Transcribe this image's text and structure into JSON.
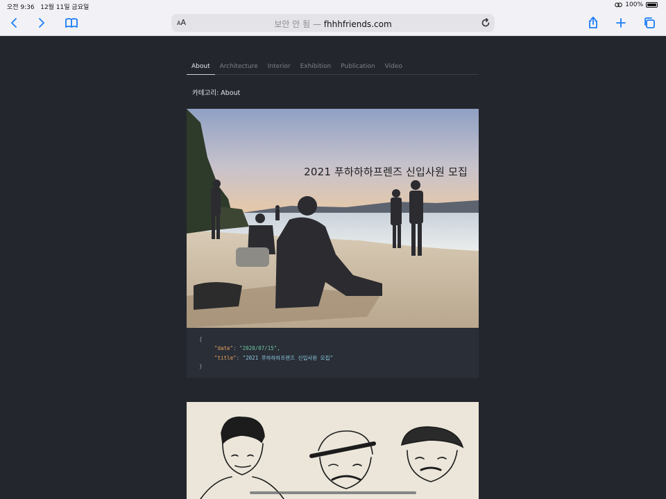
{
  "status": {
    "time": "오전 9:36",
    "date": "12월 11일 금요일",
    "battery": "100%"
  },
  "browser": {
    "aa_label": "AA",
    "insecure_label": "보안 안 됨 —",
    "domain": "fhhhfriends.com"
  },
  "nav": {
    "tabs": [
      {
        "label": "About"
      },
      {
        "label": "Architecture"
      },
      {
        "label": "Interior"
      },
      {
        "label": "Exhibition"
      },
      {
        "label": "Publication"
      },
      {
        "label": "Video"
      }
    ],
    "active_tab": "About"
  },
  "category_label": "카테고리: About",
  "post": {
    "overlay_title": "2021 푸하하하프렌즈 신입사원 모집",
    "code": {
      "open": "{",
      "date_key": "\"date\"",
      "date_value": "\"2020/07/15\",",
      "title_key": "\"title\"",
      "title_value": "\"2021 푸하하하프렌즈 신입사원 모집\"",
      "close": "}"
    }
  },
  "colors": {
    "accent": "#1a7cf5",
    "page_bg": "#23262d",
    "code_bg": "#2a2e37"
  },
  "icons": [
    "back-icon",
    "forward-icon",
    "bookmarks-icon",
    "reload-icon",
    "share-icon",
    "add-tab-icon",
    "tabs-icon",
    "wifi-icon",
    "battery-icon"
  ]
}
